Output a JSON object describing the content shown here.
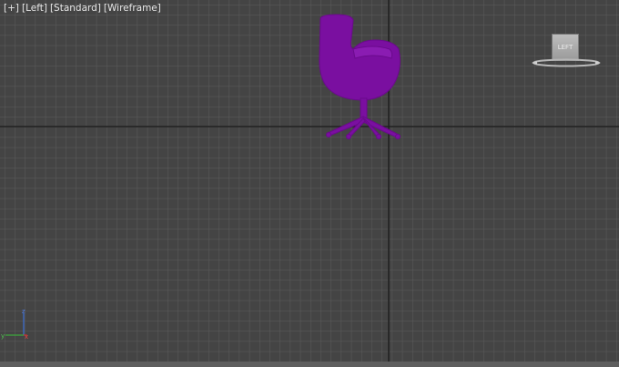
{
  "viewport": {
    "labels": [
      "[+]",
      "[Left]",
      "[Standard]",
      "[Wireframe]"
    ],
    "background_color": "#444444",
    "grid_line_color": "#5a5a5a",
    "major_axis_color": "#1e1e1e",
    "object_color": "#7a0fa0"
  },
  "viewcube": {
    "face_label": "LEFT"
  },
  "axis_tripod": {
    "z_label": "z",
    "y_label": "y",
    "x_label": "x"
  }
}
